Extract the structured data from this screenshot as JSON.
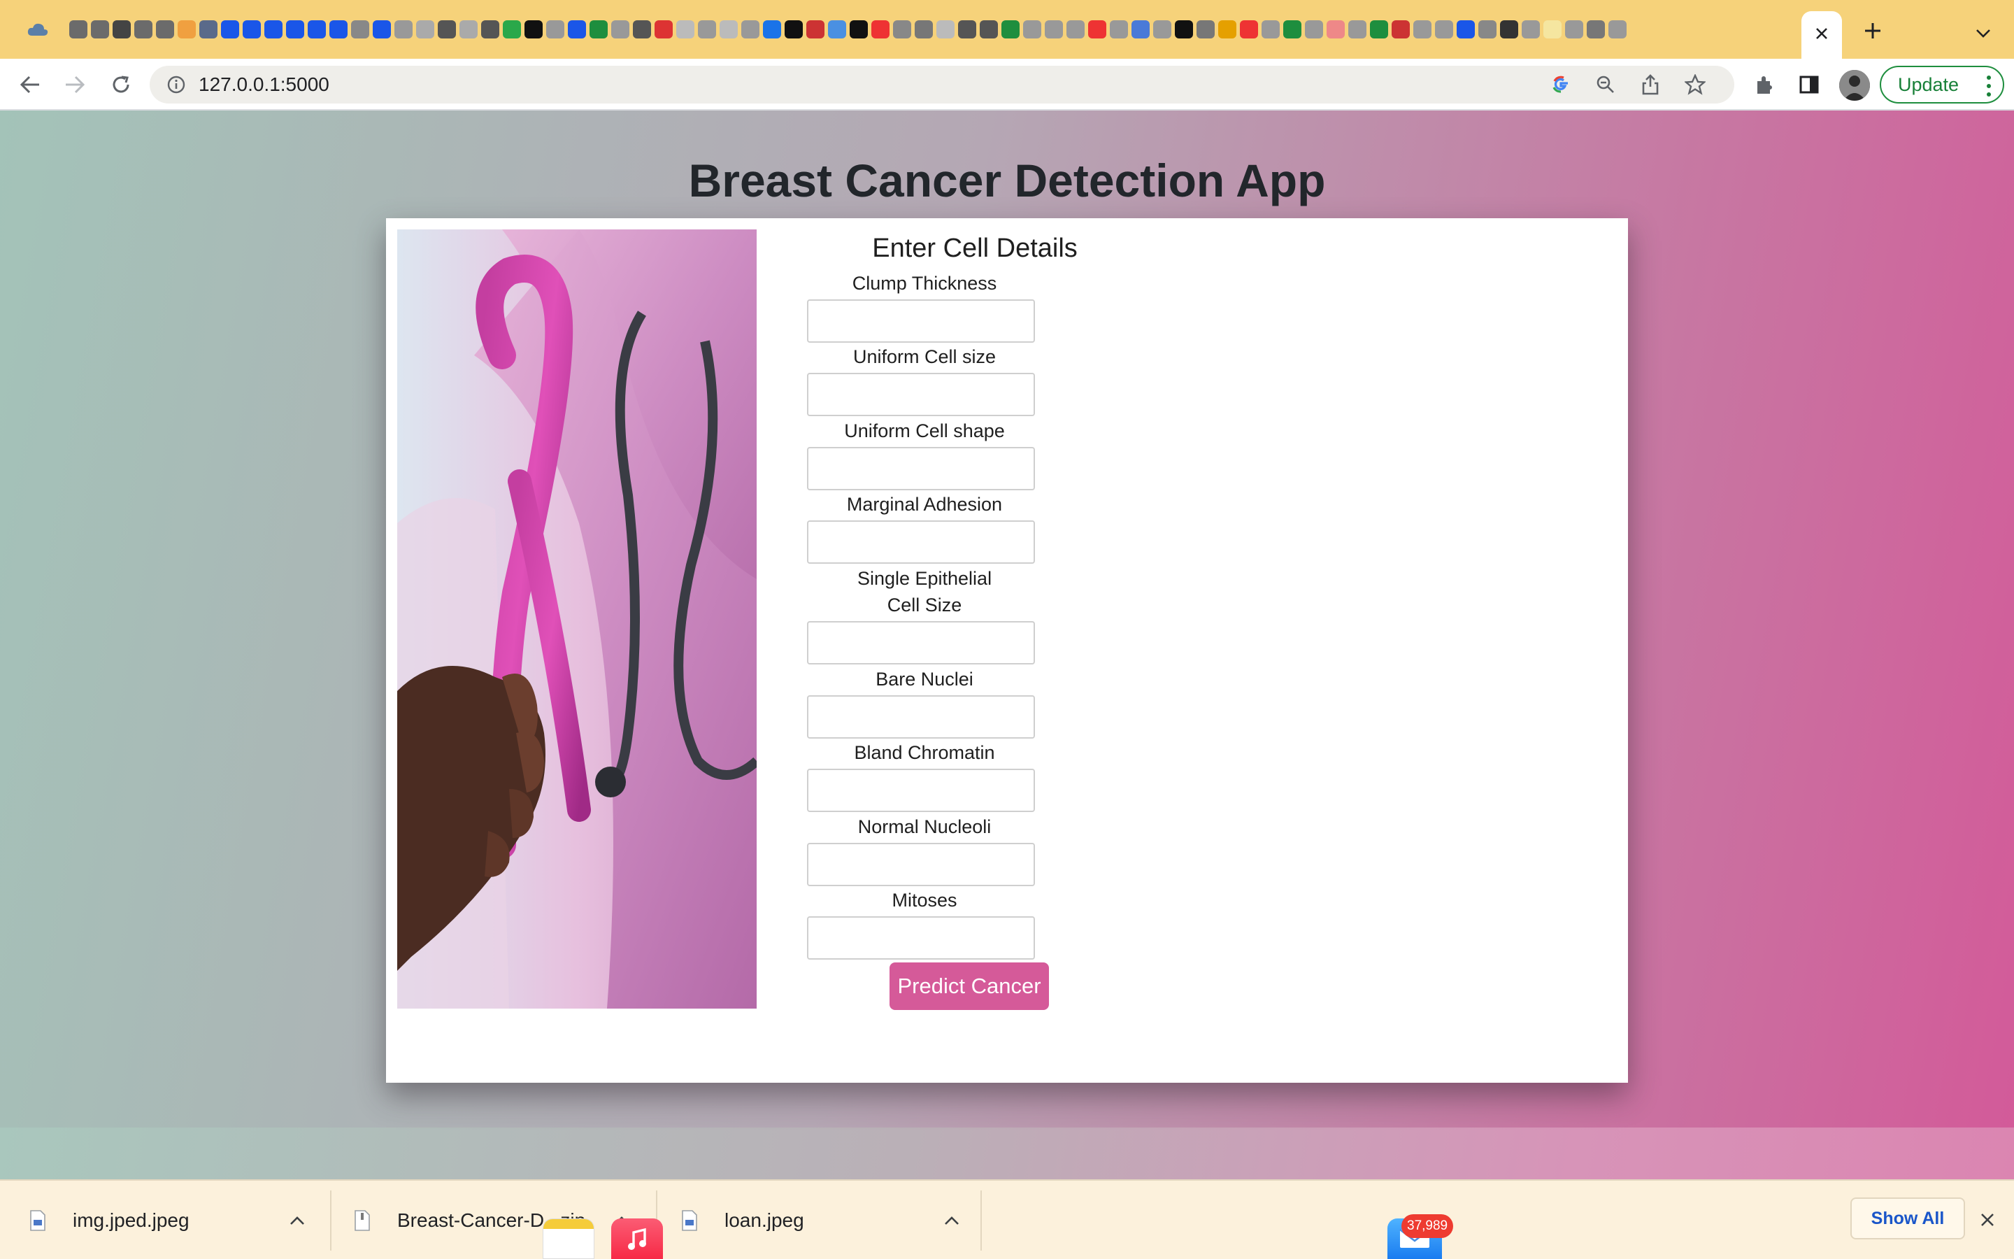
{
  "browser": {
    "tab_favicon_colors": [
      "#6b6b6b",
      "#6b6b6b",
      "#444",
      "#6b6b6b",
      "#6b6b6b",
      "#f0a040",
      "#5a6a8a",
      "#1a56e8",
      "#1a56e8",
      "#1a56e8",
      "#1a56e8",
      "#1a56e8",
      "#1a56e8",
      "#888",
      "#1a56e8",
      "#999",
      "#aaa",
      "#555",
      "#aaa",
      "#555",
      "#2aa84a",
      "#111",
      "#999",
      "#1a56e8",
      "#1e8e3e",
      "#999",
      "#555",
      "#d33",
      "#bbb",
      "#999",
      "#bbb",
      "#999",
      "#1a73e8",
      "#111",
      "#c33",
      "#4a90e2",
      "#111",
      "#e33",
      "#888",
      "#777",
      "#bbb",
      "#555",
      "#555",
      "#1e8e3e",
      "#999",
      "#999",
      "#999",
      "#e33",
      "#999",
      "#4a7ad8",
      "#999",
      "#111",
      "#777",
      "#e5a000",
      "#e33",
      "#999",
      "#1e8e3e",
      "#999",
      "#e88",
      "#999",
      "#1e8e3e",
      "#c33",
      "#999",
      "#999",
      "#1a56e8",
      "#888",
      "#333",
      "#999",
      "#f5e6a0",
      "#999",
      "#777",
      "#999"
    ],
    "active_tab_close_icon": "close-icon",
    "new_tab_icon": "plus-icon",
    "tab_list_icon": "chevron-down-icon",
    "url": "127.0.0.1:5000",
    "update_label": "Update"
  },
  "page": {
    "title": "Breast Cancer Detection App",
    "form_heading": "Enter Cell Details",
    "fields": [
      {
        "label": "Clump Thickness",
        "value": ""
      },
      {
        "label": "Uniform Cell size",
        "value": ""
      },
      {
        "label": "Uniform Cell shape",
        "value": ""
      },
      {
        "label": "Marginal Adhesion",
        "value": ""
      },
      {
        "label": "Single Epithelial\nCell Size",
        "value": ""
      },
      {
        "label": "Bare Nuclei",
        "value": ""
      },
      {
        "label": "Bland Chromatin",
        "value": ""
      },
      {
        "label": "Normal Nucleoli",
        "value": ""
      },
      {
        "label": "Mitoses",
        "value": ""
      }
    ],
    "submit_label": "Predict Cancer",
    "accent_color": "#d55a99"
  },
  "downloads": {
    "items": [
      {
        "name": "img.jped.jpeg"
      },
      {
        "name": "Breast-Cancer-D...zip"
      },
      {
        "name": "loan.jpeg"
      }
    ],
    "show_all_label": "Show All",
    "mail_badge": "37,989"
  }
}
